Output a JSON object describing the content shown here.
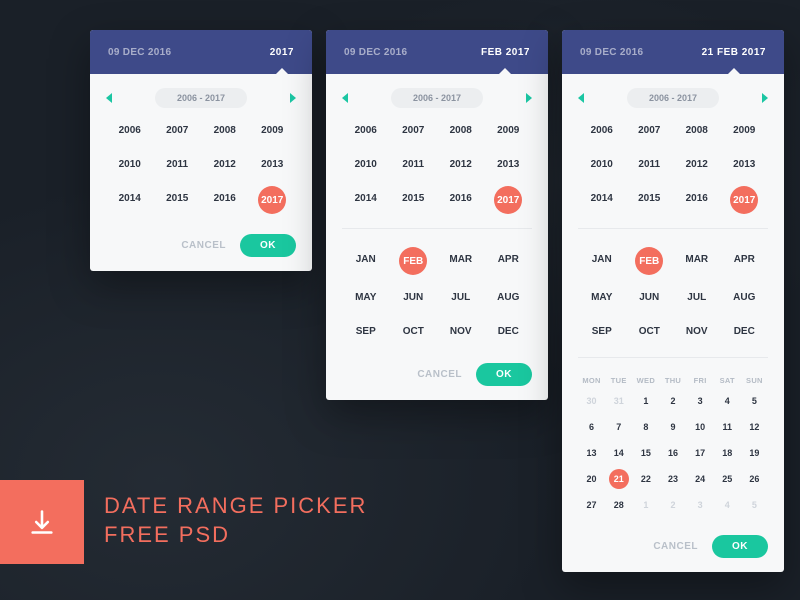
{
  "header": {
    "start_date": "09 DEC 2016",
    "end_year": "2017",
    "end_month": "FEB 2017",
    "end_day": "21 FEB 2017"
  },
  "pager": {
    "range_label": "2006 - 2017"
  },
  "years": [
    "2006",
    "2007",
    "2008",
    "2009",
    "2010",
    "2011",
    "2012",
    "2013",
    "2014",
    "2015",
    "2016",
    "2017"
  ],
  "selected_year": "2017",
  "months": [
    "JAN",
    "FEB",
    "MAR",
    "APR",
    "MAY",
    "JUN",
    "JUL",
    "AUG",
    "SEP",
    "OCT",
    "NOV",
    "DEC"
  ],
  "selected_month": "FEB",
  "dow": [
    "MON",
    "TUE",
    "WED",
    "THU",
    "FRI",
    "SAT",
    "SUN"
  ],
  "days": [
    {
      "d": 30,
      "muted": true
    },
    {
      "d": 31,
      "muted": true
    },
    {
      "d": 1
    },
    {
      "d": 2
    },
    {
      "d": 3
    },
    {
      "d": 4
    },
    {
      "d": 5
    },
    {
      "d": 6
    },
    {
      "d": 7
    },
    {
      "d": 8
    },
    {
      "d": 9
    },
    {
      "d": 10
    },
    {
      "d": 11
    },
    {
      "d": 12
    },
    {
      "d": 13
    },
    {
      "d": 14
    },
    {
      "d": 15
    },
    {
      "d": 16
    },
    {
      "d": 17
    },
    {
      "d": 18
    },
    {
      "d": 19
    },
    {
      "d": 20
    },
    {
      "d": 21,
      "sel": true
    },
    {
      "d": 22
    },
    {
      "d": 23
    },
    {
      "d": 24
    },
    {
      "d": 25
    },
    {
      "d": 26
    },
    {
      "d": 27
    },
    {
      "d": 28
    },
    {
      "d": 1,
      "muted": true
    },
    {
      "d": 2,
      "muted": true
    },
    {
      "d": 3,
      "muted": true
    },
    {
      "d": 4,
      "muted": true
    },
    {
      "d": 5,
      "muted": true
    }
  ],
  "selected_day": 21,
  "actions": {
    "cancel": "CANCEL",
    "ok": "OK"
  },
  "promo": {
    "line1": "DATE RANGE PICKER",
    "line2": "FREE PSD"
  },
  "colors": {
    "header": "#3e4a89",
    "accent": "#f36e5e",
    "ok": "#1ac79f"
  }
}
